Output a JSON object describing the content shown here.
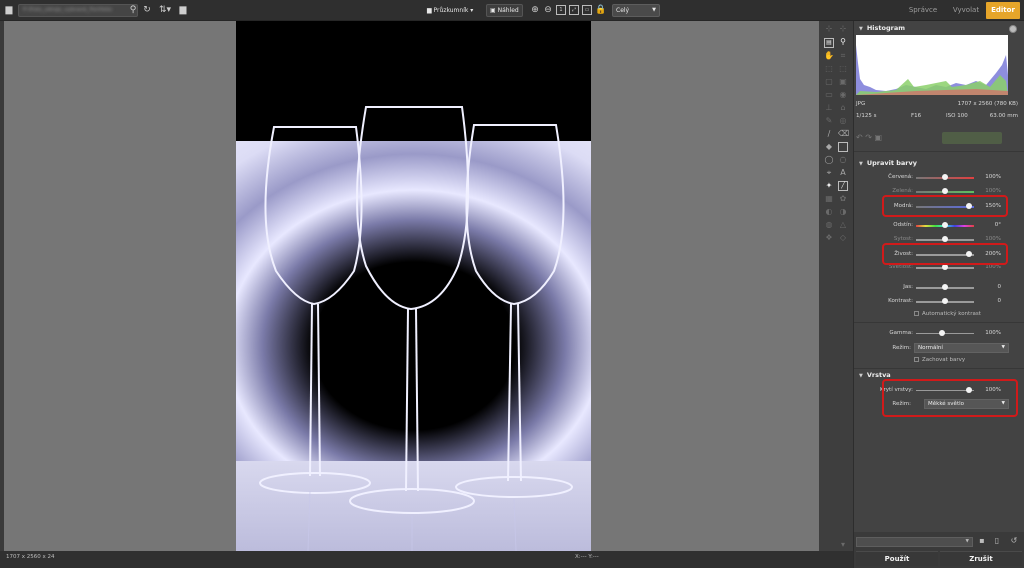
{
  "toolbar": {
    "path_text": "P:\\Foto_zdroje_vybrané_Portfolio",
    "explorer_label": "Průzkumník",
    "preview_label": "Náhled",
    "zoom_value": "Celý"
  },
  "modes": [
    {
      "label": "Správce",
      "active": false
    },
    {
      "label": "Vyvolat",
      "active": false
    },
    {
      "label": "Editor",
      "active": true
    }
  ],
  "status": {
    "dimensions": "1707 x 2560 x 24",
    "coords": "X:--- Y:---"
  },
  "histogram": {
    "title": "Histogram",
    "format": "JPG",
    "size": "1707 x 2560 (780 KB)",
    "shutter": "1/125 s",
    "aperture": "F16",
    "iso": "ISO 100",
    "focal": "63.00 mm"
  },
  "adjust": {
    "title": "Upravit barvy",
    "sliders": [
      {
        "label": "Červená:",
        "value": "100%",
        "pos": 0.5,
        "track": "red"
      },
      {
        "label": "Zelená:",
        "value": "100%",
        "pos": 0.5,
        "track": "green"
      },
      {
        "label": "Modrá:",
        "value": "150%",
        "pos": 0.92,
        "track": "blue"
      },
      {
        "label": "Odstín:",
        "value": "0°",
        "pos": 0.5,
        "track": "hue"
      },
      {
        "label": "Sytost:",
        "value": "100%",
        "pos": 0.5,
        "track": "plain"
      },
      {
        "label": "Živost:",
        "value": "200%",
        "pos": 0.92,
        "track": "plain"
      },
      {
        "label": "Světlost:",
        "value": "100%",
        "pos": 0.5,
        "track": "plain"
      },
      {
        "label": "Jas:",
        "value": "0",
        "pos": 0.5,
        "track": "plain"
      },
      {
        "label": "Kontrast:",
        "value": "0",
        "pos": 0.5,
        "track": "plain"
      }
    ],
    "auto_contrast": "Automatický kontrast",
    "gamma_label": "Gamma:",
    "gamma_value": "100%",
    "gamma_pos": 0.45,
    "mode_label": "Režim:",
    "mode_value": "Normální",
    "keep_colors": "Zachovat barvy"
  },
  "layers": {
    "title": "Vrstva",
    "opacity_label": "Krytí vrstvy:",
    "opacity_value": "100%",
    "opacity_pos": 0.92,
    "mode_label": "Režim:",
    "mode_value": "Měkké světlo"
  },
  "bottom": {
    "apply": "Použít",
    "cancel": "Zrušit"
  }
}
